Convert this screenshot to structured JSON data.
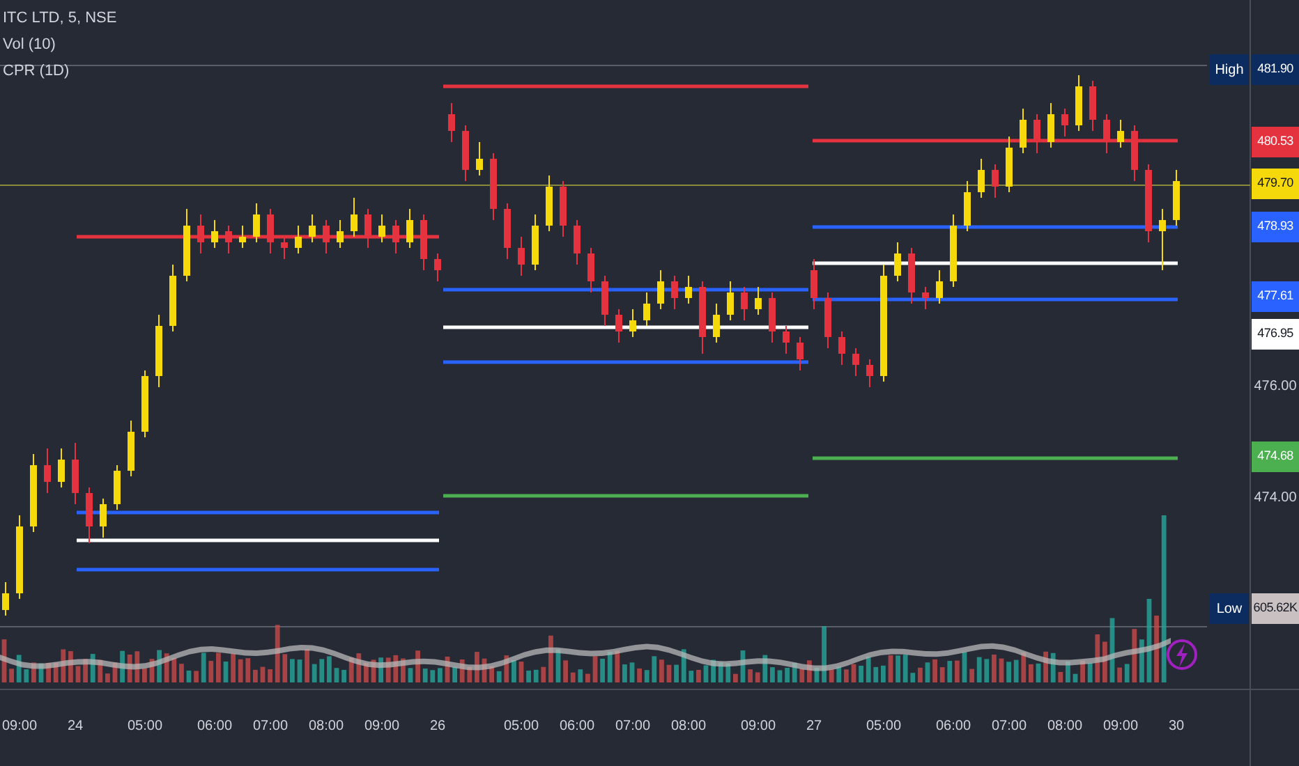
{
  "legend": [
    {
      "text": "ITC LTD, 5, NSE"
    },
    {
      "text": "Vol (10)"
    },
    {
      "text": "CPR (1D)"
    }
  ],
  "chart": {
    "chart_data": {
      "type": "candlestick",
      "ylim": [
        469.2,
        482.95
      ],
      "yticks": [
        {
          "value": 476,
          "label": "476.00"
        },
        {
          "value": 474,
          "label": "474.00"
        }
      ],
      "categories": [
        null,
        "09:00",
        null,
        null,
        null,
        "24",
        null,
        null,
        null,
        null,
        "05:00",
        null,
        null,
        null,
        null,
        "06:00",
        null,
        null,
        null,
        "07:00",
        null,
        null,
        null,
        "08:00",
        null,
        null,
        null,
        "09:00",
        null,
        null,
        null,
        "26",
        null,
        null,
        null,
        null,
        null,
        "05:00",
        null,
        null,
        null,
        "06:00",
        null,
        null,
        null,
        "07:00",
        null,
        null,
        null,
        "08:00",
        null,
        null,
        null,
        null,
        "09:00",
        null,
        null,
        null,
        "27",
        null,
        null,
        null,
        null,
        "05:00",
        null,
        null,
        null,
        null,
        "06:00",
        null,
        null,
        null,
        "07:00",
        null,
        null,
        null,
        "08:00",
        null,
        null,
        null,
        "09:00",
        null,
        null,
        null,
        "30"
      ],
      "ohlc": [
        [
          472.0,
          472.5,
          471.9,
          472.3
        ],
        [
          472.3,
          473.7,
          472.2,
          473.5
        ],
        [
          473.5,
          474.8,
          473.4,
          474.6
        ],
        [
          474.6,
          474.9,
          474.1,
          474.3
        ],
        [
          474.3,
          474.9,
          474.2,
          474.7
        ],
        [
          474.7,
          475.0,
          473.9,
          474.1
        ],
        [
          474.1,
          474.2,
          473.2,
          473.5
        ],
        [
          473.5,
          474.0,
          473.3,
          473.9
        ],
        [
          473.9,
          474.6,
          473.8,
          474.5
        ],
        [
          474.5,
          475.4,
          474.4,
          475.2
        ],
        [
          475.2,
          476.3,
          475.1,
          476.2
        ],
        [
          476.2,
          477.3,
          476.0,
          477.1
        ],
        [
          477.1,
          478.2,
          477.0,
          478.0
        ],
        [
          478.0,
          479.2,
          477.9,
          478.9
        ],
        [
          478.9,
          479.1,
          478.4,
          478.6
        ],
        [
          478.6,
          479.0,
          478.5,
          478.8
        ],
        [
          478.8,
          478.9,
          478.4,
          478.6
        ],
        [
          478.6,
          478.9,
          478.5,
          478.7
        ],
        [
          478.7,
          479.3,
          478.6,
          479.1
        ],
        [
          479.1,
          479.2,
          478.4,
          478.6
        ],
        [
          478.6,
          478.7,
          478.3,
          478.5
        ],
        [
          478.5,
          478.9,
          478.4,
          478.7
        ],
        [
          478.7,
          479.1,
          478.6,
          478.9
        ],
        [
          478.9,
          479.0,
          478.4,
          478.6
        ],
        [
          478.6,
          479.0,
          478.5,
          478.8
        ],
        [
          478.8,
          479.4,
          478.7,
          479.1
        ],
        [
          479.1,
          479.2,
          478.5,
          478.7
        ],
        [
          478.7,
          479.1,
          478.6,
          478.9
        ],
        [
          478.9,
          479.0,
          478.4,
          478.6
        ],
        [
          478.6,
          479.2,
          478.5,
          479.0
        ],
        [
          479.0,
          479.1,
          478.1,
          478.3
        ],
        [
          478.3,
          478.4,
          477.9,
          478.1
        ],
        [
          480.9,
          481.1,
          480.4,
          480.6
        ],
        [
          480.6,
          480.7,
          479.7,
          479.9
        ],
        [
          479.9,
          480.4,
          479.8,
          480.1
        ],
        [
          480.1,
          480.2,
          479.0,
          479.2
        ],
        [
          479.2,
          479.3,
          478.3,
          478.5
        ],
        [
          478.5,
          478.7,
          478.0,
          478.2
        ],
        [
          478.2,
          479.1,
          478.1,
          478.9
        ],
        [
          478.9,
          479.8,
          478.8,
          479.6
        ],
        [
          479.6,
          479.7,
          478.7,
          478.9
        ],
        [
          478.9,
          479.0,
          478.2,
          478.4
        ],
        [
          478.4,
          478.5,
          477.7,
          477.9
        ],
        [
          477.9,
          478.0,
          477.1,
          477.3
        ],
        [
          477.3,
          477.4,
          476.8,
          477.0
        ],
        [
          477.0,
          477.4,
          476.9,
          477.2
        ],
        [
          477.2,
          477.7,
          477.1,
          477.5
        ],
        [
          477.5,
          478.1,
          477.4,
          477.9
        ],
        [
          477.9,
          478.0,
          477.4,
          477.6
        ],
        [
          477.6,
          478.0,
          477.5,
          477.8
        ],
        [
          477.8,
          477.9,
          476.6,
          476.9
        ],
        [
          476.9,
          477.5,
          476.8,
          477.3
        ],
        [
          477.3,
          477.9,
          477.2,
          477.7
        ],
        [
          477.7,
          477.8,
          477.2,
          477.4
        ],
        [
          477.4,
          477.8,
          477.3,
          477.6
        ],
        [
          477.6,
          477.7,
          476.8,
          477.0
        ],
        [
          477.0,
          477.1,
          476.6,
          476.8
        ],
        [
          476.8,
          476.9,
          476.3,
          476.5
        ],
        [
          478.1,
          478.3,
          477.4,
          477.6
        ],
        [
          477.6,
          477.7,
          476.7,
          476.9
        ],
        [
          476.9,
          477.0,
          476.4,
          476.6
        ],
        [
          476.6,
          476.7,
          476.2,
          476.4
        ],
        [
          476.4,
          476.5,
          476.0,
          476.2
        ],
        [
          476.2,
          478.2,
          476.1,
          478.0
        ],
        [
          478.0,
          478.6,
          477.9,
          478.4
        ],
        [
          478.4,
          478.5,
          477.5,
          477.7
        ],
        [
          477.7,
          477.8,
          477.4,
          477.6
        ],
        [
          477.6,
          478.1,
          477.5,
          477.9
        ],
        [
          477.9,
          479.1,
          477.8,
          478.9
        ],
        [
          478.9,
          479.7,
          478.8,
          479.5
        ],
        [
          479.5,
          480.1,
          479.4,
          479.9
        ],
        [
          479.9,
          480.0,
          479.4,
          479.6
        ],
        [
          479.6,
          480.5,
          479.5,
          480.3
        ],
        [
          480.3,
          481.0,
          480.2,
          480.8
        ],
        [
          480.8,
          480.9,
          480.2,
          480.4
        ],
        [
          480.4,
          481.1,
          480.3,
          480.9
        ],
        [
          480.9,
          481.0,
          480.5,
          480.7
        ],
        [
          480.7,
          481.6,
          480.6,
          481.4
        ],
        [
          481.4,
          481.5,
          480.6,
          480.8
        ],
        [
          480.8,
          480.9,
          480.2,
          480.4
        ],
        [
          480.4,
          480.8,
          480.3,
          480.6
        ],
        [
          480.6,
          480.7,
          479.7,
          479.9
        ],
        [
          479.9,
          480.0,
          478.6,
          478.8
        ],
        [
          478.8,
          479.2,
          478.1,
          479.0
        ],
        [
          479.0,
          479.9,
          478.9,
          479.7
        ]
      ]
    }
  },
  "price_tags": [
    {
      "label": "High",
      "text": "481.90",
      "color": "#0c2b5e"
    },
    {
      "text": "480.53",
      "color": "#e5323f"
    },
    {
      "text": "479.70",
      "color": "#f5d90a"
    },
    {
      "text": "478.93",
      "color": "#2962ff"
    },
    {
      "text": "477.61",
      "color": "#2962ff"
    },
    {
      "text": "476.95",
      "color": "#ffffff"
    },
    {
      "text": "474.68",
      "color": "#4caf50"
    },
    {
      "label": "Low",
      "text": "605.62K",
      "color": "#c9c1c1"
    }
  ]
}
